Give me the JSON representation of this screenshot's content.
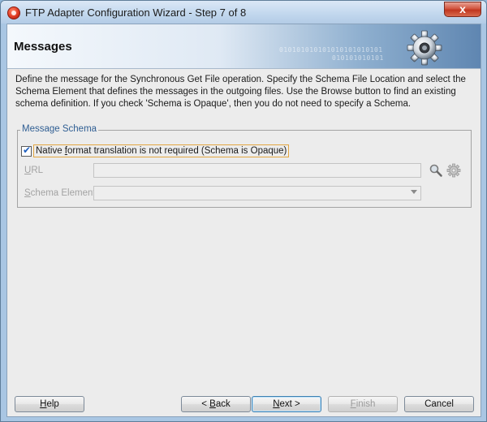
{
  "window": {
    "title": "FTP Adapter Configuration Wizard - Step 7 of 8",
    "close_label": "x"
  },
  "header": {
    "title": "Messages",
    "binary_line1": "010101010101010101010101",
    "binary_line2": "010101010101"
  },
  "description": "Define the message for the Synchronous Get File operation.  Specify the Schema File Location and select the Schema Element that defines the messages in the outgoing files. Use the Browse button to find an existing schema definition. If you check 'Schema is Opaque', then you do not need to specify a Schema.",
  "message_schema": {
    "legend": "Message Schema",
    "opaque_checkbox": {
      "checked": true,
      "label_prefix": "Native ",
      "label_mnemonic": "f",
      "label_suffix": "ormat translation is not required (Schema is Opaque)"
    },
    "url": {
      "label_mnemonic": "U",
      "label_rest": "RL",
      "value": ""
    },
    "schema_element": {
      "label_mnemonic": "S",
      "label_rest": "chema Element",
      "value": ""
    }
  },
  "buttons": {
    "help": {
      "mnemonic": "H",
      "rest": "elp"
    },
    "back": {
      "prefix": "< ",
      "mnemonic": "B",
      "rest": "ack"
    },
    "next": {
      "mnemonic": "N",
      "rest": "ext >"
    },
    "finish": {
      "mnemonic": "F",
      "rest": "inish"
    },
    "cancel": {
      "label": "Cancel"
    }
  },
  "colors": {
    "accent_legend": "#2f5e93",
    "close_button": "#c03720",
    "focus_border": "#e2a642"
  },
  "icons": [
    "app-icon",
    "close-icon",
    "gear-icon",
    "magnifier-icon",
    "gear-small-icon",
    "chevron-down-icon",
    "check-icon"
  ]
}
